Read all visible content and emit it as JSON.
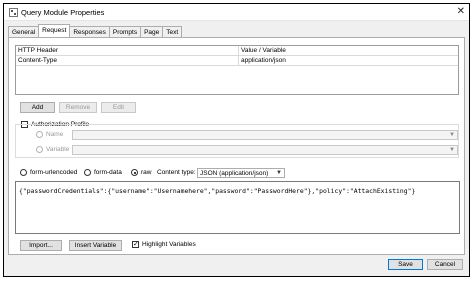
{
  "window": {
    "title": "Query Module Properties",
    "close_glyph": "✕"
  },
  "tabs": [
    {
      "label": "General",
      "active": false
    },
    {
      "label": "Request",
      "active": true
    },
    {
      "label": "Responses",
      "active": false
    },
    {
      "label": "Prompts",
      "active": false
    },
    {
      "label": "Page",
      "active": false
    },
    {
      "label": "Text",
      "active": false
    }
  ],
  "headers": {
    "columns": [
      "HTTP Header",
      "Value / Variable"
    ],
    "rows": [
      {
        "header": "Content-Type",
        "value": "application/json"
      }
    ]
  },
  "header_buttons": {
    "add": "Add",
    "remove": "Remove",
    "edit": "Edit"
  },
  "auth": {
    "label": "Authorization Profile",
    "checked": false,
    "name_label": "Name",
    "variable_label": "Variable"
  },
  "body_options": {
    "urlencoded": "form-urlencoded",
    "formdata": "form-data",
    "raw": "raw",
    "selected": "raw",
    "content_type_label": "Content type:",
    "content_type_value": "JSON (application/json)"
  },
  "body_text": "{\"passwordCredentials\":{\"username\":\"Usernamehere\",\"password\":\"PasswordHere\"},\"policy\":\"AttachExisting\"}",
  "bottom": {
    "import": "Import...",
    "insert_variable": "Insert Variable",
    "highlight_label": "Highlight Variables",
    "highlight_checked": true
  },
  "dialog_buttons": {
    "save": "Save",
    "cancel": "Cancel"
  }
}
